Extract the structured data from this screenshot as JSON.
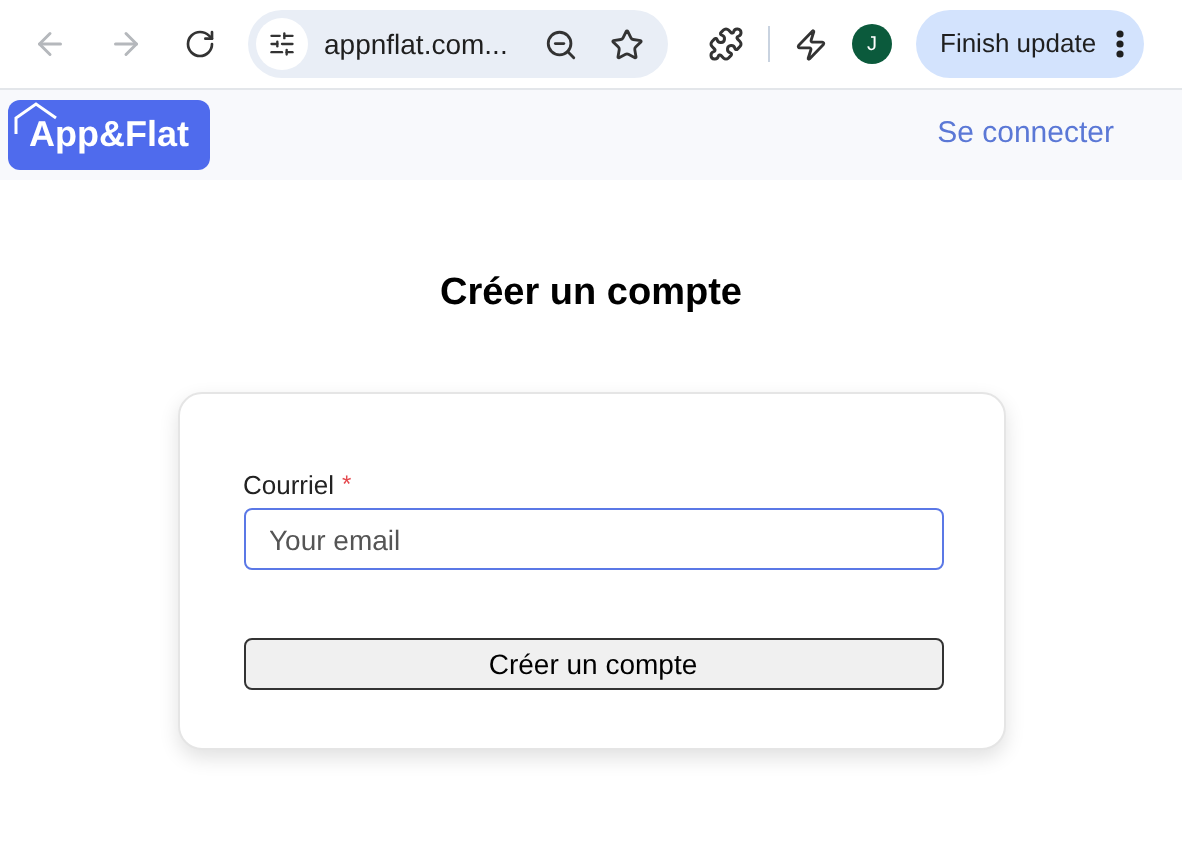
{
  "browser": {
    "url": "appnflat.com...",
    "avatar": "J",
    "update_button": "Finish update"
  },
  "header": {
    "logo": "App&Flat",
    "login_link": "Se connecter"
  },
  "title": "Créer un compte",
  "form": {
    "field": {
      "label": "Courriel",
      "required_mark": "*",
      "placeholder": "Your email"
    },
    "submit": "Créer un compte"
  }
}
